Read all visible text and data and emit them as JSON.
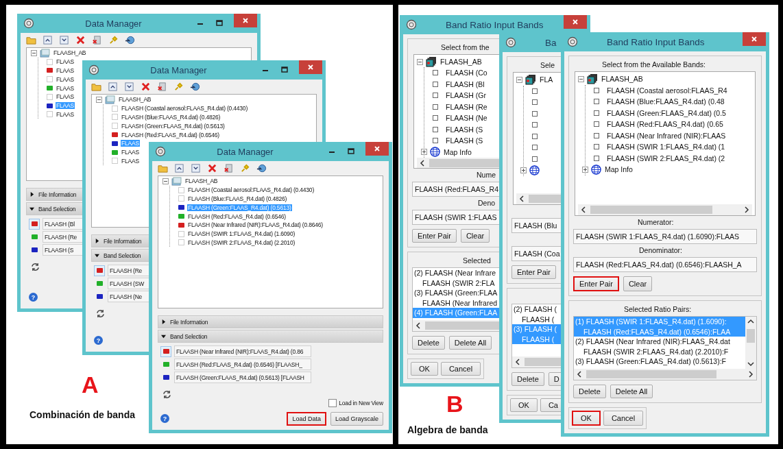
{
  "panel_a": {
    "letter": "A",
    "caption": "Combinación de banda",
    "windows": [
      {
        "kind": "data_manager",
        "title": "Data Manager",
        "tree_root": "FLAASH_AB",
        "bands": [
          {
            "label": "FLAAS",
            "checked": false,
            "selected": false
          },
          {
            "label": "FLAAS",
            "color": "#d42020",
            "selected": false
          },
          {
            "label": "FLAAS",
            "checked": false,
            "selected": false
          },
          {
            "label": "FLAAS",
            "color": "#22b02a",
            "selected": false
          },
          {
            "label": "FLAAS",
            "checked": false,
            "selected": false
          },
          {
            "label": "FLAAS",
            "color": "#1c24c0",
            "selected": true
          },
          {
            "label": "FLAAS",
            "checked": false,
            "selected": false
          }
        ],
        "file_information": "File Information",
        "band_selection": "Band Selection",
        "band_slots": [
          {
            "label": "FLAASH (Bl",
            "color": "#d42020",
            "selected": true
          },
          {
            "label": "FLAASH (Re",
            "color": "#22b02a",
            "selected": false
          },
          {
            "label": "FLAASH (S",
            "color": "#1c24c0",
            "selected": false
          }
        ],
        "help": "?"
      },
      {
        "kind": "data_manager",
        "title": "Data Manager",
        "tree_root": "FLAASH_AB",
        "bands": [
          {
            "label": "FLAASH (Coastal aerosol:FLAAS_R4.dat) (0.4430)",
            "checked": false,
            "selected": false
          },
          {
            "label": "FLAASH (Blue:FLAAS_R4.dat) (0.4826)",
            "checked": false,
            "selected": false
          },
          {
            "label": "FLAASH (Green:FLAAS_R4.dat) (0.5613)",
            "checked": false,
            "selected": false
          },
          {
            "label": "FLAASH (Red:FLAAS_R4.dat) (0.6546)",
            "color": "#d42020",
            "selected": false
          },
          {
            "label": "FLAAS",
            "color": "#1c24c0",
            "selected": true
          },
          {
            "label": "FLAAS",
            "color": "#22b02a",
            "selected": false
          },
          {
            "label": "FLAAS",
            "checked": false,
            "selected": false
          }
        ],
        "file_information": "File Information",
        "band_selection": "Band Selection",
        "band_slots": [
          {
            "label": "FLAASH (Re",
            "color": "#d42020",
            "selected": true
          },
          {
            "label": "FLAASH (SW",
            "color": "#22b02a",
            "selected": false
          },
          {
            "label": "FLAASH (Ne",
            "color": "#1c24c0",
            "selected": false
          }
        ],
        "help": "?"
      },
      {
        "kind": "data_manager",
        "title": "Data Manager",
        "tree_root": "FLAASH_AB",
        "bands": [
          {
            "label": "FLAASH (Coastal aerosol:FLAAS_R4.dat) (0.4430)",
            "checked": false,
            "selected": false
          },
          {
            "label": "FLAASH (Blue:FLAAS_R4.dat) (0.4826)",
            "checked": false,
            "selected": false
          },
          {
            "label": "FLAASH (Green:FLAAS_R4.dat) (0.5613)",
            "color": "#1c24c0",
            "selected": true
          },
          {
            "label": "FLAASH (Red:FLAAS_R4.dat) (0.6546)",
            "color": "#22b02a",
            "selected": false
          },
          {
            "label": "FLAASH (Near Infrared (NIR):FLAAS_R4.dat) (0.8646)",
            "color": "#d42020",
            "selected": false
          },
          {
            "label": "FLAASH (SWIR 1:FLAAS_R4.dat) (1.6090)",
            "checked": false,
            "selected": false
          },
          {
            "label": "FLAASH (SWIR 2:FLAAS_R4.dat) (2.2010)",
            "checked": false,
            "selected": false
          }
        ],
        "file_information": "File Information",
        "band_selection": "Band Selection",
        "band_slots": [
          {
            "label": "FLAASH (Near Infrared (NIR):FLAAS_R4.dat) (0.86",
            "color": "#d42020",
            "selected": true
          },
          {
            "label": "FLAASH (Red:FLAAS_R4.dat) (0.6546) [FLAASH_",
            "color": "#22b02a",
            "selected": false
          },
          {
            "label": "FLAASH (Green:FLAAS_R4.dat) (0.5613) [FLAASH",
            "color": "#1c24c0",
            "selected": false
          }
        ],
        "load_in_new_view": {
          "label": "Load in New View",
          "checked": false
        },
        "buttons": [
          {
            "label": "Load Data",
            "highlighted": true
          },
          {
            "label": "Load Grayscale",
            "highlighted": false
          }
        ],
        "help": "?"
      }
    ]
  },
  "panel_b": {
    "letter": "B",
    "caption": "Algebra de banda",
    "windows": [
      {
        "kind": "band_ratio",
        "title": "Band Ratio Input Bands",
        "select_label": "Select from the",
        "tree_root": "FLAASH_AB",
        "bands": [
          {
            "label": "FLAASH (Co",
            "checked": false
          },
          {
            "label": "FLAASH (Bl",
            "checked": false
          },
          {
            "label": "FLAASH (Gr",
            "checked": false
          },
          {
            "label": "FLAASH (Re",
            "checked": false
          },
          {
            "label": "FLAASH (Ne",
            "checked": false
          },
          {
            "label": "FLAASH (S",
            "checked": false
          },
          {
            "label": "FLAASH (S",
            "checked": false
          }
        ],
        "map_info": "Map Info",
        "numerator_label": "Nume",
        "numerator": "FLAASH (Red:FLAAS_R4",
        "denominator_label": "Deno",
        "denominator": "FLAASH (SWIR 1:FLAAS",
        "pair_buttons": [
          {
            "label": "Enter Pair",
            "highlighted": false
          },
          {
            "label": "Clear",
            "highlighted": false
          }
        ],
        "pairs_label": "Selected",
        "pairs": [
          {
            "lines": [
              "(2) FLAASH (Near Infrare",
              "FLAASH (SWIR 2:FLA"
            ],
            "selected": false
          },
          {
            "lines": [
              "(3) FLAASH (Green:FLAA",
              "FLAASH (Near Infrared"
            ],
            "selected": false
          },
          {
            "lines": [
              "(4) FLAASH (Green:FLAA"
            ],
            "selected": true
          }
        ],
        "list_buttons": [
          {
            "label": "Delete",
            "highlighted": false
          },
          {
            "label": "Delete All",
            "highlighted": false
          }
        ],
        "dialog_buttons": [
          {
            "label": "OK",
            "highlighted": false
          },
          {
            "label": "Cancel",
            "highlighted": false
          }
        ]
      },
      {
        "kind": "band_ratio",
        "title": "Ba",
        "select_label": "Sele",
        "tree_root": "FLA",
        "bands": [
          {
            "checked": false
          },
          {
            "checked": false
          },
          {
            "checked": false
          },
          {
            "checked": false
          },
          {
            "checked": false
          },
          {
            "checked": false
          },
          {
            "checked": false
          }
        ],
        "numerator": "FLAASH (Blu",
        "denominator": "FLAASH (Coa",
        "pair_buttons": [
          {
            "label": "Enter Pair",
            "highlighted": false
          }
        ],
        "pairs": [
          {
            "lines": [
              "(2) FLAASH (",
              "FLAASH ("
            ],
            "selected": false
          },
          {
            "lines": [
              "(3) FLAASH (",
              "FLAASH ("
            ],
            "selected": true
          }
        ],
        "list_buttons": [
          {
            "label": "Delete",
            "highlighted": false
          },
          {
            "label": "D",
            "highlighted": false
          }
        ],
        "dialog_buttons": [
          {
            "label": "OK",
            "highlighted": false
          },
          {
            "label": "Ca",
            "highlighted": false
          }
        ]
      },
      {
        "kind": "band_ratio",
        "title": "Band Ratio Input Bands",
        "select_label": "Select from the Available Bands:",
        "tree_root": "FLAASH_AB",
        "bands": [
          {
            "label": "FLAASH (Coastal aerosol:FLAAS_R4",
            "checked": false
          },
          {
            "label": "FLAASH (Blue:FLAAS_R4.dat) (0.48",
            "checked": false
          },
          {
            "label": "FLAASH (Green:FLAAS_R4.dat) (0.5",
            "checked": false
          },
          {
            "label": "FLAASH (Red:FLAAS_R4.dat) (0.65",
            "checked": false
          },
          {
            "label": "FLAASH (Near Infrared (NIR):FLAAS",
            "checked": false
          },
          {
            "label": "FLAASH (SWIR 1:FLAAS_R4.dat) (1",
            "checked": false
          },
          {
            "label": "FLAASH (SWIR 2:FLAAS_R4.dat) (2",
            "checked": false
          }
        ],
        "map_info": "Map Info",
        "numerator_label": "Numerator:",
        "numerator": "FLAASH (SWIR 1:FLAAS_R4.dat) (1.6090):FLAAS",
        "denominator_label": "Denominator:",
        "denominator": "FLAASH (Red:FLAAS_R4.dat) (0.6546):FLAASH_A",
        "pair_buttons": [
          {
            "label": "Enter Pair",
            "highlighted": true
          },
          {
            "label": "Clear",
            "highlighted": false
          }
        ],
        "pairs_label": "Selected Ratio Pairs:",
        "pairs": [
          {
            "lines": [
              "(1) FLAASH (SWIR 1:FLAAS_R4.dat) (1.6090):",
              "FLAASH (Red:FLAAS_R4.dat) (0.6546):FLAA"
            ],
            "selected": true
          },
          {
            "lines": [
              "(2) FLAASH (Near Infrared (NIR):FLAAS_R4.dat",
              "FLAASH (SWIR 2:FLAAS_R4.dat) (2.2010):F"
            ],
            "selected": false
          },
          {
            "lines": [
              "(3) FLAASH (Green:FLAAS_R4.dat) (0.5613):F"
            ],
            "selected": false
          }
        ],
        "list_buttons": [
          {
            "label": "Delete",
            "highlighted": false
          },
          {
            "label": "Delete All",
            "highlighted": false
          }
        ],
        "dialog_buttons": [
          {
            "label": "OK",
            "highlighted": true
          },
          {
            "label": "Cancel",
            "highlighted": false
          }
        ]
      }
    ]
  }
}
